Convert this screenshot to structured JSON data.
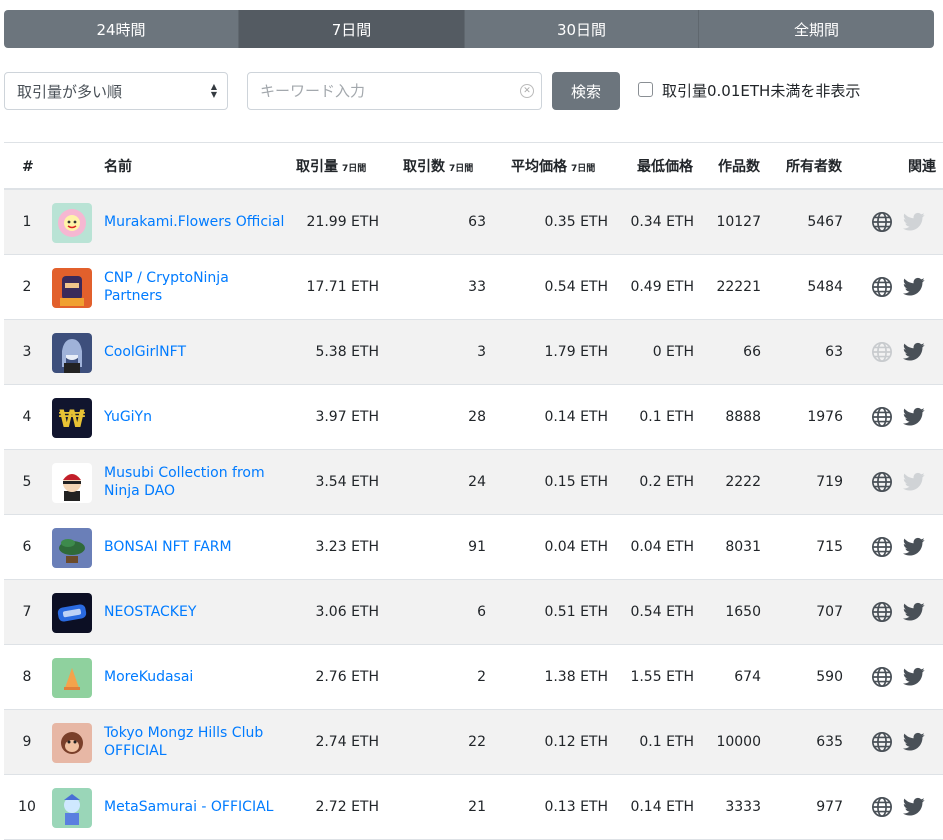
{
  "tabs": [
    "24時間",
    "7日間",
    "30日間",
    "全期間"
  ],
  "active_tab": 1,
  "filters": {
    "sort_value": "取引量が多い順",
    "search_placeholder": "キーワード入力",
    "search_button": "検索",
    "hide_small_label": "取引量0.01ETH未満を非表示",
    "hide_small_checked": false
  },
  "columns": {
    "rank": "#",
    "name": "名前",
    "volume": "取引量",
    "volume_note": "7日間",
    "sales": "取引数",
    "sales_note": "7日間",
    "avg_price": "平均価格",
    "avg_note": "7日間",
    "floor_price": "最低価格",
    "items": "作品数",
    "owners": "所有者数",
    "links": "関連"
  },
  "rows": [
    {
      "rank": "1",
      "name": "Murakami.Flowers Official",
      "volume": "21.99 ETH",
      "sales": "63",
      "avg": "0.35 ETH",
      "floor": "0.34 ETH",
      "items": "10127",
      "owners": "5467",
      "web": true,
      "twitter": false,
      "avatar": {
        "bg": "#b9e3d5",
        "icon": "flower"
      }
    },
    {
      "rank": "2",
      "name": "CNP / CryptoNinja Partners",
      "volume": "17.71 ETH",
      "sales": "33",
      "avg": "0.54 ETH",
      "floor": "0.49 ETH",
      "items": "22221",
      "owners": "5484",
      "web": true,
      "twitter": true,
      "avatar": {
        "bg": "#e2602c",
        "icon": "ninja"
      }
    },
    {
      "rank": "3",
      "name": "CoolGirlNFT",
      "volume": "5.38 ETH",
      "sales": "3",
      "avg": "1.79 ETH",
      "floor": "0 ETH",
      "items": "66",
      "owners": "63",
      "web": false,
      "twitter": true,
      "avatar": {
        "bg": "#3d4f7c",
        "icon": "girl"
      }
    },
    {
      "rank": "4",
      "name": "YuGiYn",
      "volume": "3.97 ETH",
      "sales": "28",
      "avg": "0.14 ETH",
      "floor": "0.1 ETH",
      "items": "8888",
      "owners": "1976",
      "web": true,
      "twitter": true,
      "avatar": {
        "bg": "#11152e",
        "icon": "yen"
      }
    },
    {
      "rank": "5",
      "name": "Musubi Collection from Ninja DAO",
      "volume": "3.54 ETH",
      "sales": "24",
      "avg": "0.15 ETH",
      "floor": "0.2 ETH",
      "items": "2222",
      "owners": "719",
      "web": true,
      "twitter": false,
      "avatar": {
        "bg": "#ffffff",
        "icon": "musubi"
      }
    },
    {
      "rank": "6",
      "name": "BONSAI NFT FARM",
      "volume": "3.23 ETH",
      "sales": "91",
      "avg": "0.04 ETH",
      "floor": "0.04 ETH",
      "items": "8031",
      "owners": "715",
      "web": true,
      "twitter": true,
      "avatar": {
        "bg": "#6a7fb8",
        "icon": "bonsai"
      }
    },
    {
      "rank": "7",
      "name": "NEOSTACKEY",
      "volume": "3.06 ETH",
      "sales": "6",
      "avg": "0.51 ETH",
      "floor": "0.54 ETH",
      "items": "1650",
      "owners": "707",
      "web": true,
      "twitter": true,
      "avatar": {
        "bg": "#0c0f24",
        "icon": "keyboard"
      }
    },
    {
      "rank": "8",
      "name": "MoreKudasai",
      "volume": "2.76 ETH",
      "sales": "2",
      "avg": "1.38 ETH",
      "floor": "1.55 ETH",
      "items": "674",
      "owners": "590",
      "web": true,
      "twitter": true,
      "avatar": {
        "bg": "#8fd19e",
        "icon": "cone"
      }
    },
    {
      "rank": "9",
      "name": "Tokyo Mongz Hills Club OFFICIAL",
      "volume": "2.74 ETH",
      "sales": "22",
      "avg": "0.12 ETH",
      "floor": "0.1 ETH",
      "items": "10000",
      "owners": "635",
      "web": true,
      "twitter": true,
      "avatar": {
        "bg": "#e7b7a5",
        "icon": "monkey"
      }
    },
    {
      "rank": "10",
      "name": "MetaSamurai - OFFICIAL",
      "volume": "2.72 ETH",
      "sales": "21",
      "avg": "0.13 ETH",
      "floor": "0.14 ETH",
      "items": "3333",
      "owners": "977",
      "web": true,
      "twitter": true,
      "avatar": {
        "bg": "#9ad6b8",
        "icon": "samurai"
      }
    }
  ]
}
